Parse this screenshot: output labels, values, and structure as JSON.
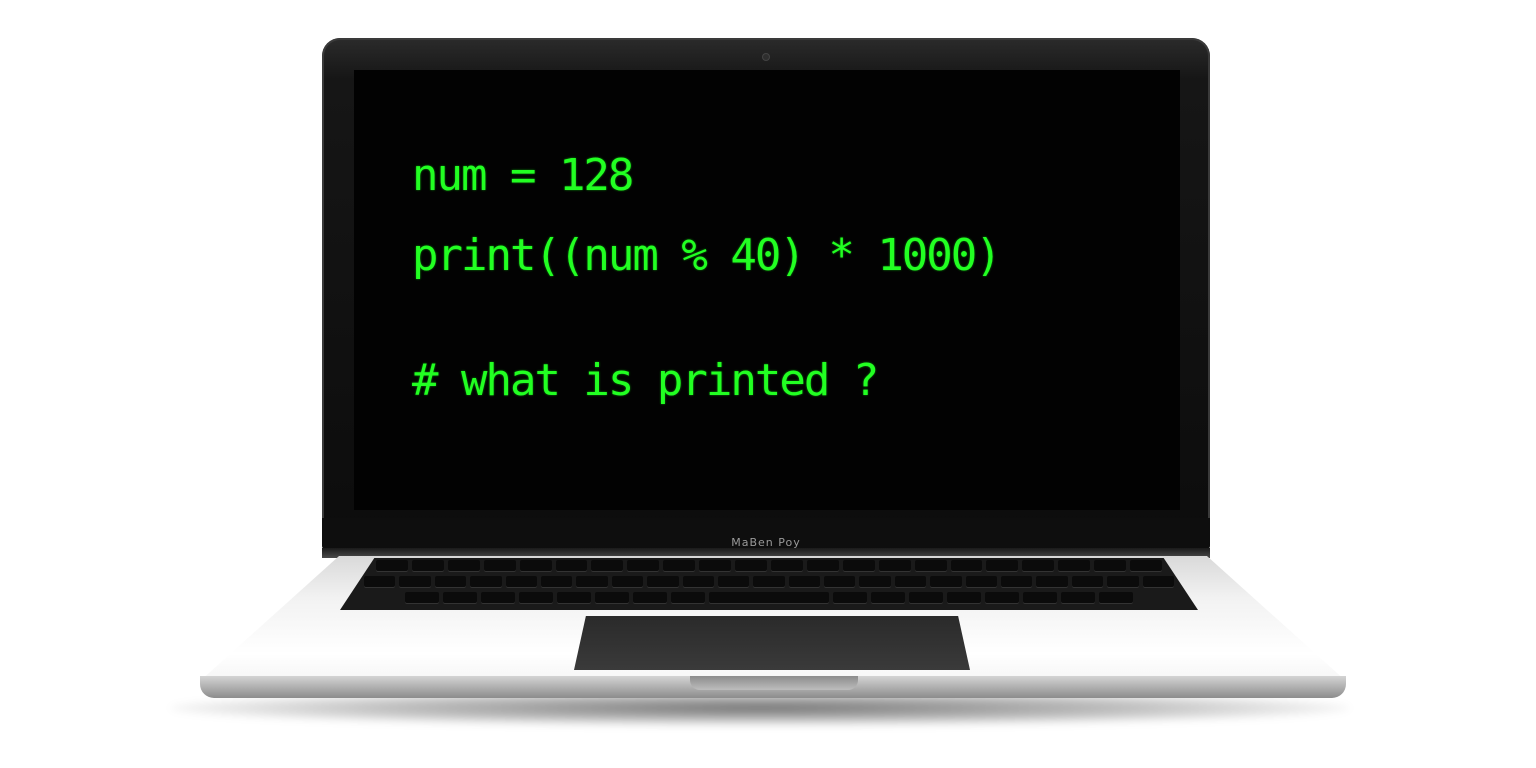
{
  "screen": {
    "code_lines": [
      "num = 128",
      "print((num % 40) * 1000)",
      "# what is printed ?"
    ],
    "text_color": "#22ff22",
    "background_color": "#020202"
  },
  "laptop": {
    "brand_label": "MaBen Poy",
    "body_color": "#f2f2f2",
    "bezel_color": "#0c0c0c"
  },
  "icons": [
    "camera-icon"
  ]
}
